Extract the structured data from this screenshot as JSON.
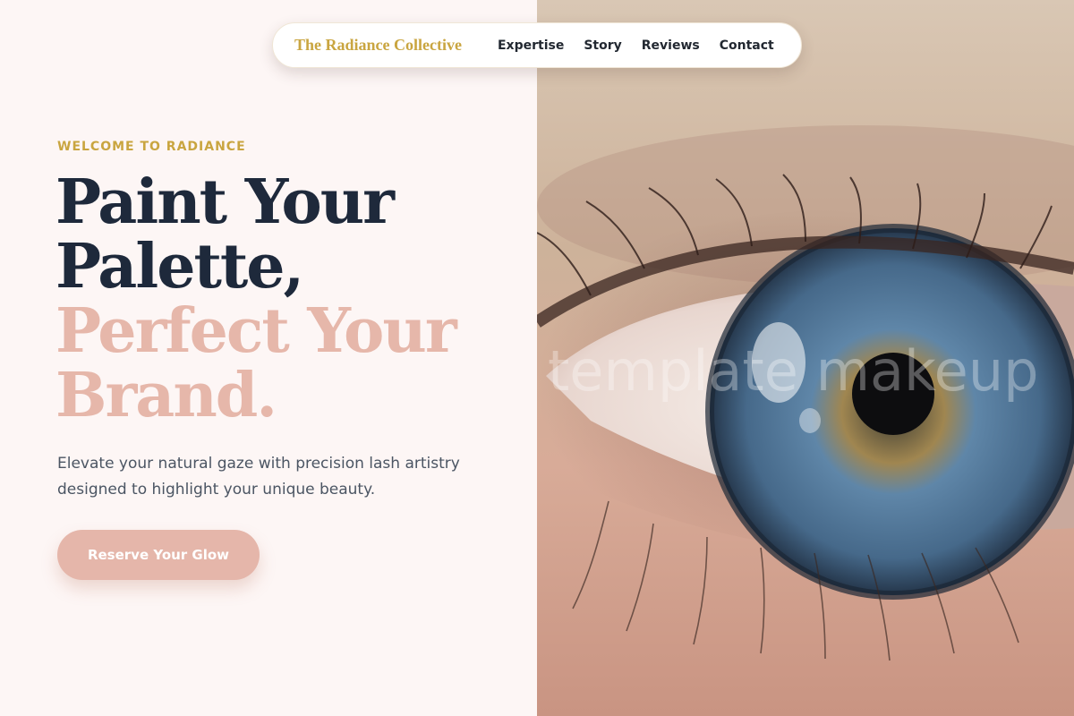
{
  "nav": {
    "brand": "The Radiance Collective",
    "links": [
      "Expertise",
      "Story",
      "Reviews",
      "Contact"
    ]
  },
  "hero": {
    "eyebrow": "WELCOME TO RADIANCE",
    "headline_dark": [
      "Paint Your",
      "Palette,"
    ],
    "headline_accent": [
      "Perfect Your",
      "Brand."
    ],
    "description": "Elevate your natural gaze with precision lash artistry designed to highlight your unique beauty.",
    "cta_label": "Reserve Your Glow"
  },
  "image": {
    "subject": "close-up-blue-eye-icon",
    "watermark": "template makeup"
  },
  "colors": {
    "background": "#fdf6f5",
    "gold": "#c9a540",
    "dark": "#1e293b",
    "accent_pink": "#e6b7aa",
    "body_text": "#4b5563",
    "button": "#e5b6aa"
  }
}
